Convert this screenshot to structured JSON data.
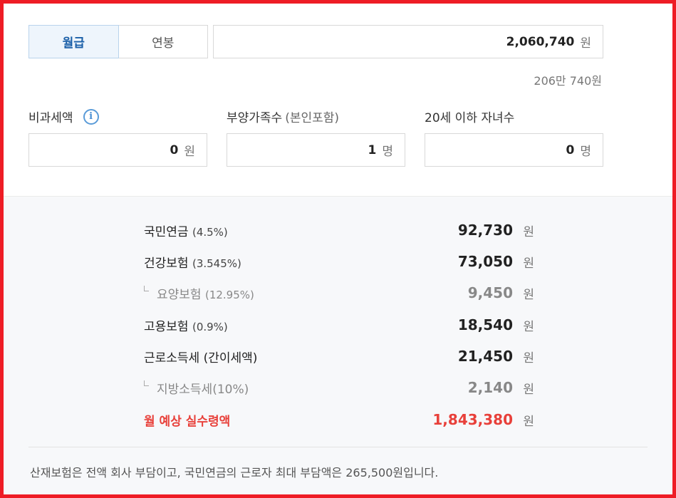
{
  "tabs": {
    "monthly": "월급",
    "annual": "연봉"
  },
  "salary": {
    "value": "2,060,740",
    "unit": "원",
    "korean_readout": "206만 740원"
  },
  "fields": {
    "nontaxable": {
      "label": "비과세액",
      "value": "0",
      "unit": "원"
    },
    "dependents": {
      "label": "부양가족수",
      "paren": "(본인포함)",
      "value": "1",
      "unit": "명"
    },
    "children": {
      "label": "20세 이하 자녀수",
      "value": "0",
      "unit": "명"
    }
  },
  "deductions": [
    {
      "name": "국민연금",
      "rate": "(4.5%)",
      "amount": "92,730",
      "unit": "원"
    },
    {
      "name": "건강보험",
      "rate": "(3.545%)",
      "amount": "73,050",
      "unit": "원"
    },
    {
      "name": "요양보험",
      "rate": "(12.95%)",
      "amount": "9,450",
      "unit": "원"
    },
    {
      "name": "고용보험",
      "rate": "(0.9%)",
      "amount": "18,540",
      "unit": "원"
    },
    {
      "name": "근로소득세",
      "rate": "(간이세액)",
      "amount": "21,450",
      "unit": "원"
    },
    {
      "name": "지방소득세(10%)",
      "rate": "",
      "amount": "2,140",
      "unit": "원"
    }
  ],
  "net": {
    "label": "월 예상 실수령액",
    "amount": "1,843,380",
    "unit": "원"
  },
  "note": "산재보험은 전액 회사 부담이고, 국민연금의 근로자 최대 부담액은 265,500원입니다.",
  "colors": {
    "frame": "#ee1c25",
    "accent_blue": "#1a5fa8",
    "net_red": "#e8403a"
  },
  "icons": {
    "info": "info-circle-icon"
  }
}
